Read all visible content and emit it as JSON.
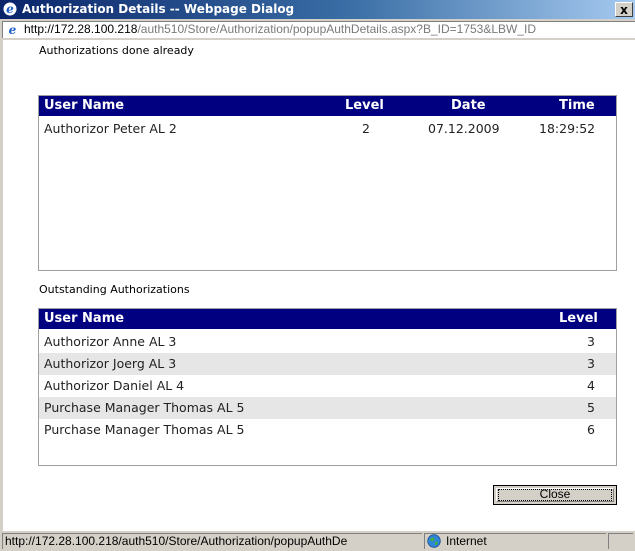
{
  "window": {
    "title": "Authorization Details -- Webpage Dialog",
    "close_glyph": "x"
  },
  "address": {
    "host": "http://172.28.100.218",
    "path": "/auth510/Store/Authorization/popupAuthDetails.aspx?B_ID=1753&LBW_ID"
  },
  "done": {
    "label": "Authorizations done already",
    "headers": {
      "user": "User Name",
      "level": "Level",
      "date": "Date",
      "time": "Time"
    },
    "rows": [
      {
        "user": "Authorizor Peter AL 2",
        "level": "2",
        "date": "07.12.2009",
        "time": "18:29:52"
      }
    ]
  },
  "outstanding": {
    "label": "Outstanding Authorizations",
    "headers": {
      "user": "User Name",
      "level": "Level"
    },
    "rows": [
      {
        "user": "Authorizor Anne AL 3",
        "level": "3"
      },
      {
        "user": "Authorizor Joerg AL 3",
        "level": "3"
      },
      {
        "user": "Authorizor Daniel AL 4",
        "level": "4"
      },
      {
        "user": "Purchase Manager Thomas AL 5",
        "level": "5"
      },
      {
        "user": "Purchase Manager Thomas AL 5",
        "level": "6"
      }
    ]
  },
  "actions": {
    "close_label": "Close"
  },
  "status": {
    "url": "http://172.28.100.218/auth510/Store/Authorization/popupAuthDe",
    "zone": "Internet"
  },
  "icons": {
    "ie": "ie-icon",
    "globe": "globe-icon"
  }
}
